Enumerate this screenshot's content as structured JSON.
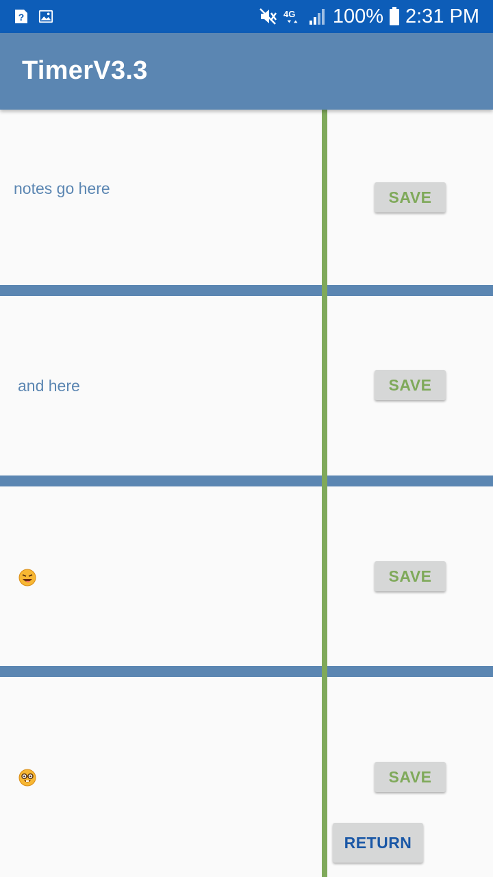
{
  "status_bar": {
    "left_icons": [
      "help-notification-icon",
      "image-notification-icon"
    ],
    "right_icons": [
      "mute-icon",
      "4g-lte-icon",
      "signal-icon",
      "battery-icon"
    ],
    "network": "4G",
    "battery": "100%",
    "time": "2:31 PM",
    "bg_color": "#0d5db8"
  },
  "app_bar": {
    "title": "TimerV3.3",
    "bg_color": "#5b86b2"
  },
  "rows": [
    {
      "note": "notes go here",
      "save_label": "SAVE"
    },
    {
      "note": "and here",
      "save_label": "SAVE"
    },
    {
      "note_emoji": "winking-tongue-emoji",
      "save_label": "SAVE"
    },
    {
      "note_emoji": "nerd-face-emoji",
      "save_label": "SAVE"
    }
  ],
  "return_label": "RETURN",
  "colors": {
    "accent_green": "#7fa95a",
    "separator_blue": "#5b86b2",
    "return_blue": "#1a57a6",
    "button_gray": "#d6d7d7"
  }
}
